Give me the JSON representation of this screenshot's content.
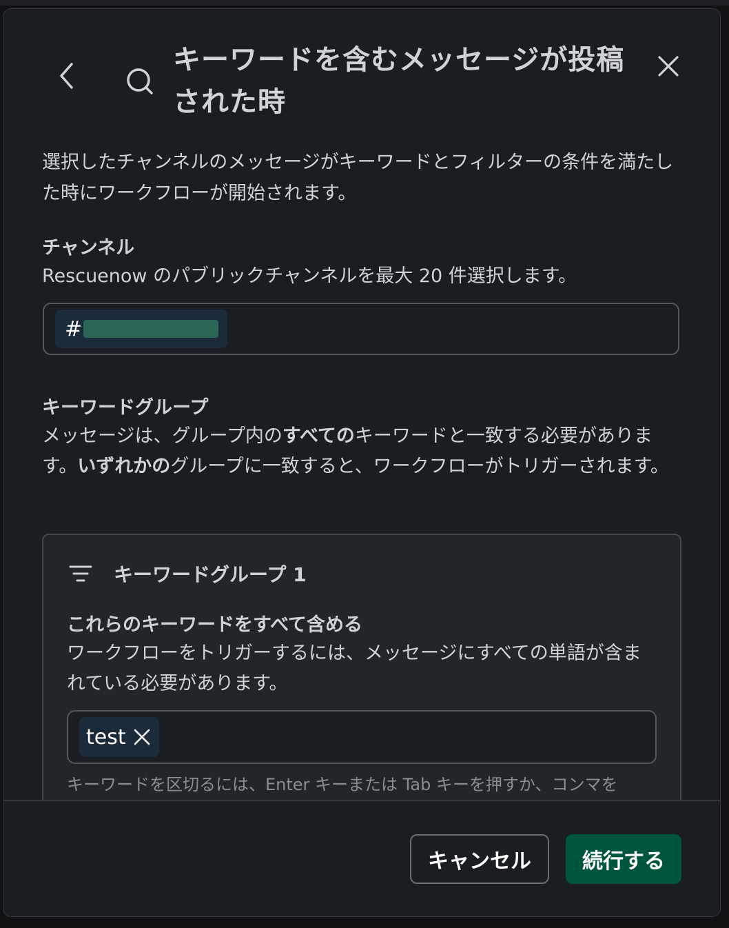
{
  "modal": {
    "title": "キーワードを含むメッセージが投稿された時",
    "description": "選択したチャンネルのメッセージがキーワードとフィルターの条件を満たした時にワークフローが開始されます。"
  },
  "channel": {
    "label": "チャンネル",
    "help": "Rescuenow のパブリックチャンネルを最大 20 件選択します。",
    "selected_prefix": "#"
  },
  "keyword_group_section": {
    "label": "キーワードグループ",
    "help_part1": "メッセージは、グループ内の",
    "help_bold1": "すべての",
    "help_part2": "キーワードと一致する必要があります。",
    "help_bold2": "いずれかの",
    "help_part3": "グループに一致すると、ワークフローがトリガーされます。"
  },
  "keyword_group": {
    "title": "キーワードグループ 1",
    "include_label": "これらのキーワードをすべて含める",
    "include_help": "ワークフローをトリガーするには、メッセージにすべての単語が含まれている必要があります。",
    "keywords": [
      "test"
    ],
    "hint": "キーワードを区切るには、Enter キーまたは Tab キーを押すか、コンマを"
  },
  "footer": {
    "cancel_label": "キャンセル",
    "continue_label": "続行する"
  },
  "colors": {
    "modal_bg": "#1a1d21",
    "chip_bg": "#1b2b3a",
    "primary_button": "#00553d"
  },
  "icons": [
    "chevron-left-icon",
    "search-icon",
    "close-icon",
    "filter-lines-icon",
    "remove-x-icon"
  ]
}
